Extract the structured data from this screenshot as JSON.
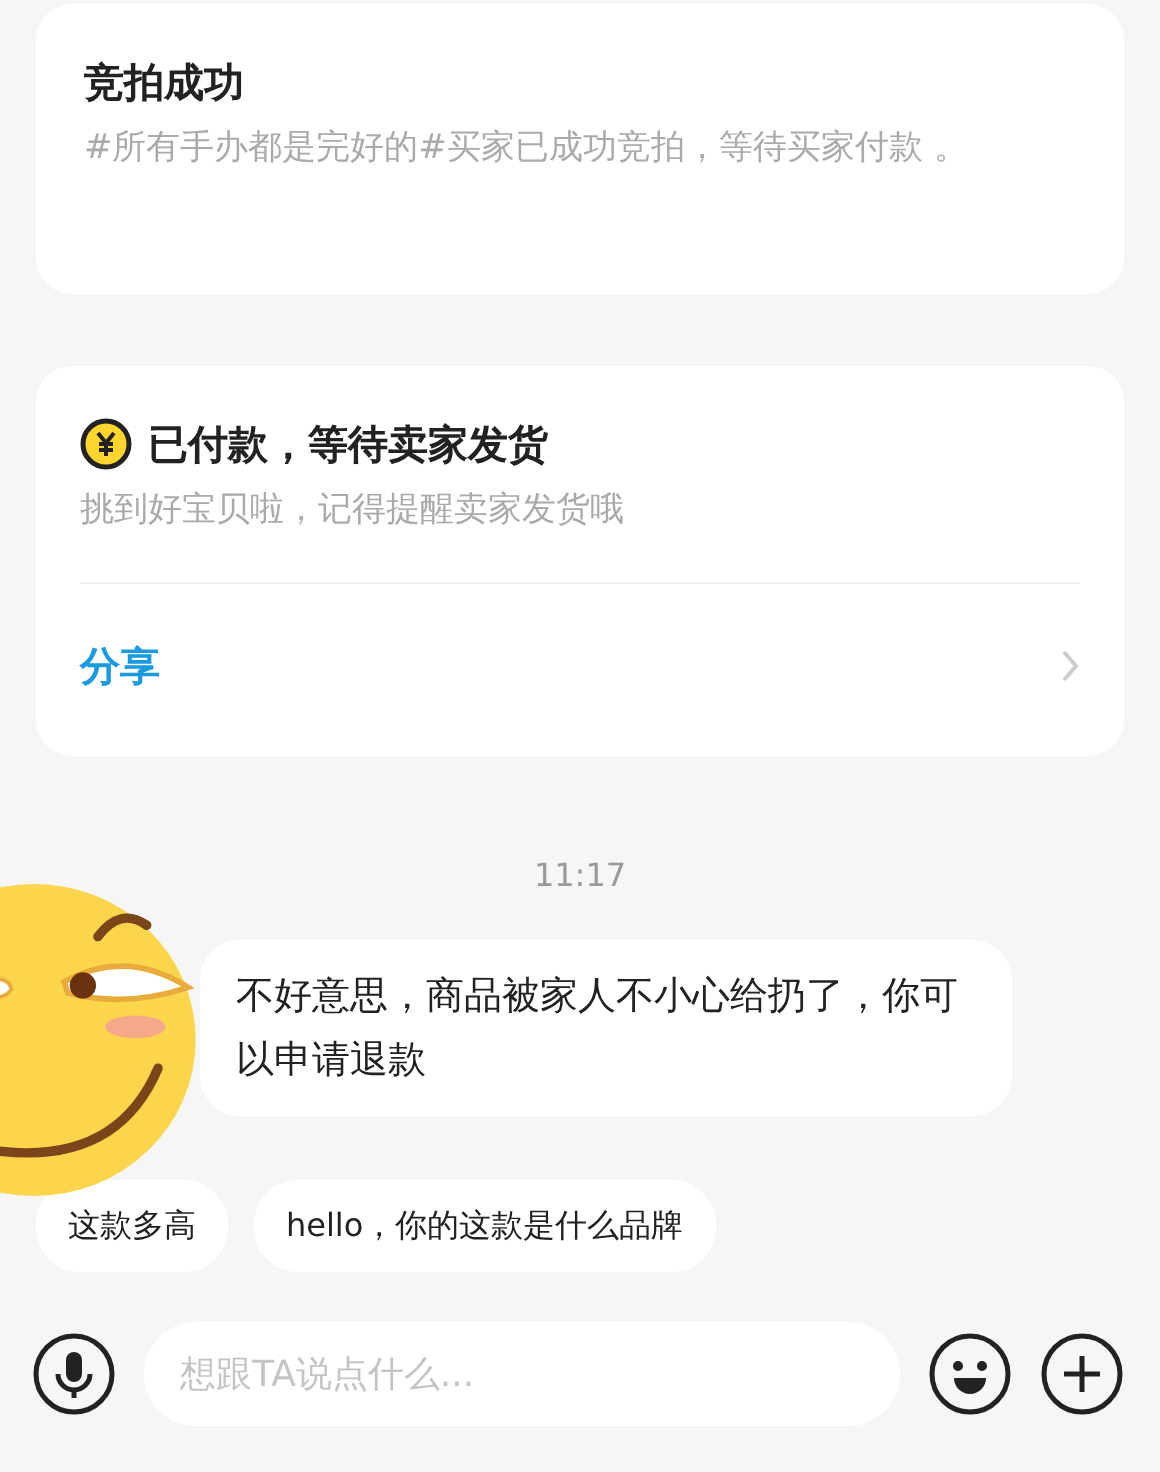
{
  "auction_card": {
    "title": "竞拍成功",
    "description": "#所有手办都是完好的#买家已成功竞拍，等待买家付款 。"
  },
  "order_card": {
    "title": "已付款，等待卖家发货",
    "description": "挑到好宝贝啦，记得提醒卖家发货哦",
    "link": "分享"
  },
  "timestamp": "11:17",
  "messages": [
    {
      "text": "不好意思，商品被家人不小心给扔了，你可以申请退款"
    }
  ],
  "quick_replies": [
    "这款多高",
    "hello，你的这款是什么品牌"
  ],
  "composer": {
    "placeholder": "想跟TA说点什么..."
  }
}
